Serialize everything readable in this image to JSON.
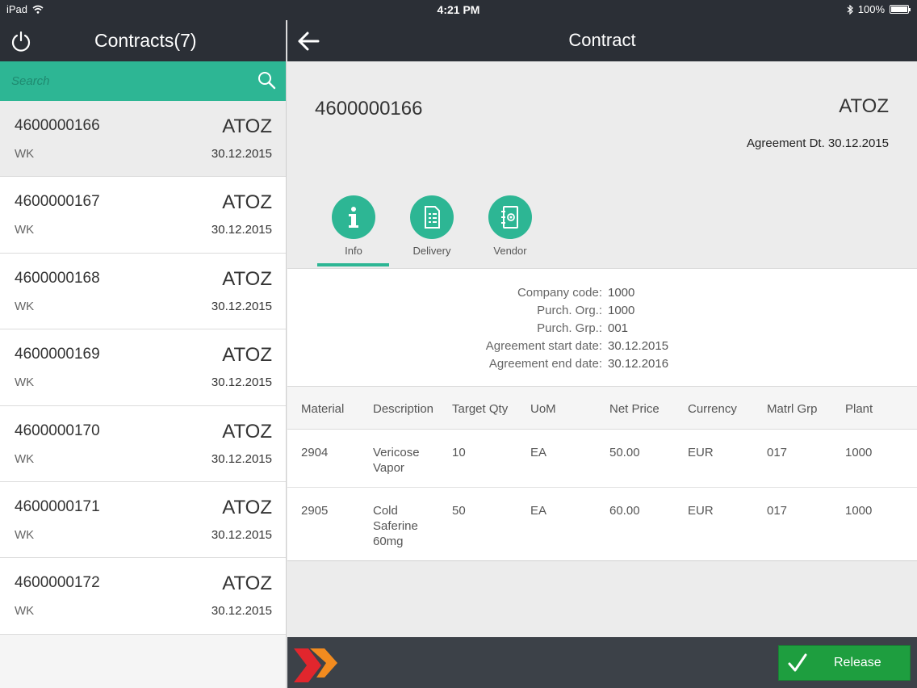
{
  "status_bar": {
    "device": "iPad",
    "time": "4:21 PM",
    "battery": "100%"
  },
  "left_pane": {
    "title": "Contracts(7)",
    "search": {
      "placeholder": "Search"
    },
    "contracts": [
      {
        "number": "4600000166",
        "vendor": "ATOZ",
        "group": "WK",
        "date": "30.12.2015"
      },
      {
        "number": "4600000167",
        "vendor": "ATOZ",
        "group": "WK",
        "date": "30.12.2015"
      },
      {
        "number": "4600000168",
        "vendor": "ATOZ",
        "group": "WK",
        "date": "30.12.2015"
      },
      {
        "number": "4600000169",
        "vendor": "ATOZ",
        "group": "WK",
        "date": "30.12.2015"
      },
      {
        "number": "4600000170",
        "vendor": "ATOZ",
        "group": "WK",
        "date": "30.12.2015"
      },
      {
        "number": "4600000171",
        "vendor": "ATOZ",
        "group": "WK",
        "date": "30.12.2015"
      },
      {
        "number": "4600000172",
        "vendor": "ATOZ",
        "group": "WK",
        "date": "30.12.2015"
      }
    ]
  },
  "detail": {
    "title": "Contract",
    "contract_number": "4600000166",
    "vendor": "ATOZ",
    "agreement_date": "Agreement Dt. 30.12.2015",
    "tabs": [
      {
        "label": "Info",
        "icon": "info-icon"
      },
      {
        "label": "Delivery",
        "icon": "delivery-document-icon"
      },
      {
        "label": "Vendor",
        "icon": "vendor-contact-book-icon"
      }
    ],
    "info": [
      {
        "key": "Company code:",
        "value": "1000"
      },
      {
        "key": "Purch. Org.:",
        "value": "1000"
      },
      {
        "key": "Purch. Grp.:",
        "value": "001"
      },
      {
        "key": "Agreement start date:",
        "value": "30.12.2015"
      },
      {
        "key": "Agreement end date:",
        "value": "30.12.2016"
      }
    ],
    "table": {
      "headers": [
        "Material",
        "Description",
        "Target Qty",
        "UoM",
        "Net Price",
        "Currency",
        "Matrl Grp",
        "Plant"
      ],
      "rows": [
        {
          "material": "2904",
          "description": "Vericose Vapor",
          "target_qty": "10",
          "uom": "EA",
          "net_price": "50.00",
          "currency": "EUR",
          "matrl_grp": "017",
          "plant": "1000"
        },
        {
          "material": "2905",
          "description": "Cold Saferine 60mg",
          "target_qty": "50",
          "uom": "EA",
          "net_price": "60.00",
          "currency": "EUR",
          "matrl_grp": "017",
          "plant": "1000"
        }
      ]
    },
    "release_label": "Release"
  },
  "colors": {
    "accent": "#2db694",
    "header": "#2b2f36",
    "release": "#1e9e3f"
  }
}
